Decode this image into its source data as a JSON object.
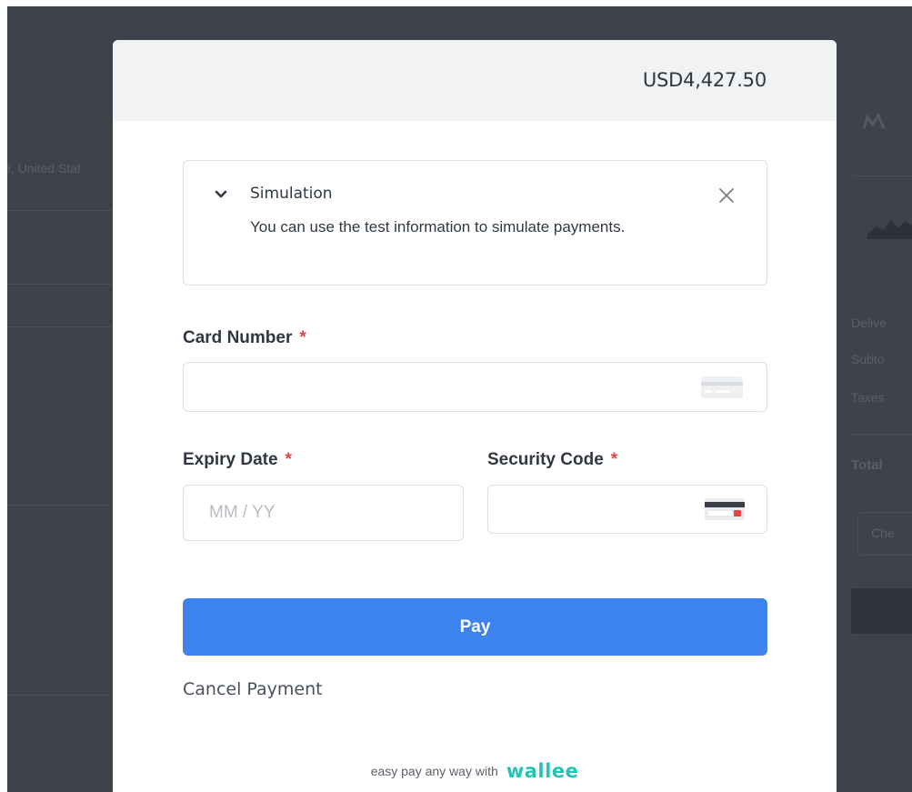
{
  "header": {
    "amount": "USD4,427.50"
  },
  "simulation": {
    "title": "Simulation",
    "description": "You can use the test information to simulate payments."
  },
  "form": {
    "card_number": {
      "label": "Card Number",
      "required_mark": "*",
      "value": "",
      "placeholder": ""
    },
    "expiry_date": {
      "label": "Expiry Date",
      "required_mark": "*",
      "value": "",
      "placeholder": "MM / YY"
    },
    "security_code": {
      "label": "Security Code",
      "required_mark": "*",
      "value": "",
      "placeholder": ""
    }
  },
  "actions": {
    "pay_label": "Pay",
    "cancel_label": "Cancel Payment"
  },
  "footer": {
    "tagline": "easy pay any way with",
    "brand": "wallee"
  },
  "background": {
    "address_fragment": "8, United Stat",
    "summary_labels": [
      "Delive",
      "Subto",
      "Taxes"
    ],
    "total_label": "Total",
    "field_fragment": "Che"
  },
  "colors": {
    "accent": "#3d83ee",
    "brand": "#25c2b5",
    "required": "#e14545",
    "backdrop": "#3e434b"
  }
}
